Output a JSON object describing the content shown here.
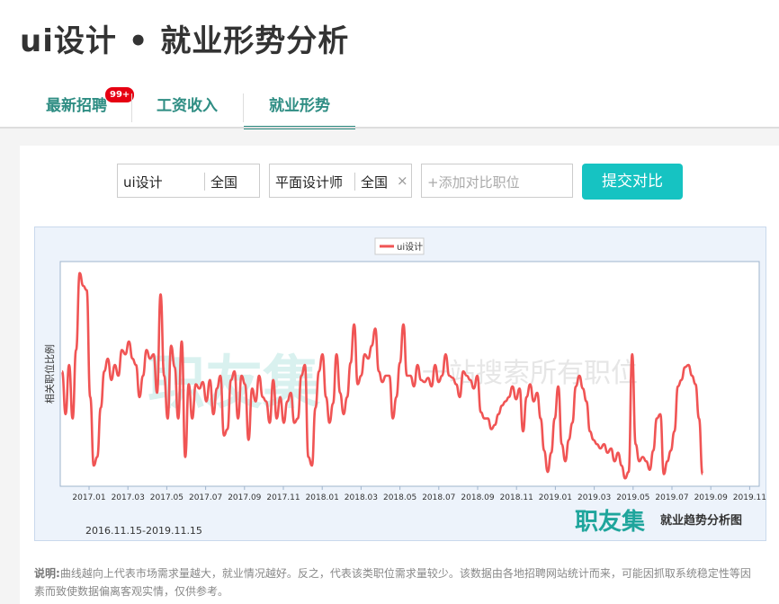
{
  "page": {
    "title": "ui设计 • 就业形势分析"
  },
  "tabs": [
    {
      "label": "最新招聘",
      "badge": "99+"
    },
    {
      "label": "工资收入"
    },
    {
      "label": "就业形势",
      "active": true
    }
  ],
  "compare": {
    "items": [
      {
        "job": "ui设计",
        "city": "全国"
      },
      {
        "job": "平面设计师",
        "city": "全国",
        "close": "×"
      }
    ],
    "add_placeholder": "+添加对比职位",
    "submit_label": "提交对比"
  },
  "chart_data": {
    "type": "line",
    "ylabel": "相关职位比例",
    "legend_placement": "top-center",
    "x_tick_labels": [
      "2017.01",
      "2017.03",
      "2017.05",
      "2017.07",
      "2017.09",
      "2017.11",
      "2018.01",
      "2018.03",
      "2018.05",
      "2018.07",
      "2018.09",
      "2018.11",
      "2019.01",
      "2019.03",
      "2019.05",
      "2019.07",
      "2019.09",
      "2019.11"
    ],
    "date_range": "2016.11.15-2019.11.15",
    "y_axis_labels_shown": false,
    "series": [
      {
        "name": "ui设计",
        "color": "#f05454",
        "comment_values": "relative values 0-100, sampled roughly every 7 days from 2016.11.15",
        "values": [
          52,
          32,
          55,
          30,
          62,
          98,
          92,
          90,
          40,
          8,
          12,
          35,
          52,
          58,
          48,
          55,
          50,
          62,
          60,
          66,
          58,
          55,
          40,
          50,
          62,
          58,
          60,
          42,
          88,
          50,
          30,
          64,
          54,
          30,
          66,
          12,
          46,
          30,
          46,
          44,
          47,
          38,
          48,
          32,
          44,
          50,
          22,
          25,
          48,
          52,
          30,
          50,
          46,
          20,
          44,
          38,
          50,
          40,
          38,
          28,
          48,
          30,
          40,
          28,
          38,
          42,
          28,
          30,
          50,
          55,
          12,
          8,
          35,
          52,
          60,
          40,
          28,
          37,
          60,
          42,
          32,
          40,
          56,
          74,
          46,
          50,
          60,
          58,
          64,
          72,
          52,
          47,
          50,
          50,
          30,
          40,
          56,
          74,
          50,
          50,
          45,
          55,
          48,
          47,
          49,
          45,
          55,
          47,
          50,
          60,
          50,
          49,
          46,
          40,
          52,
          50,
          48,
          44,
          50,
          33,
          30,
          30,
          25,
          27,
          32,
          36,
          38,
          40,
          45,
          39,
          44,
          24,
          40,
          46,
          38,
          42,
          30,
          15,
          5,
          14,
          30,
          45,
          18,
          10,
          20,
          28,
          45,
          50,
          44,
          38,
          24,
          20,
          18,
          16,
          18,
          14,
          16,
          10,
          14,
          8,
          2,
          5,
          60,
          18,
          10,
          12,
          10,
          6,
          15,
          30,
          32,
          4,
          10,
          15,
          24,
          45,
          48,
          54,
          55,
          50,
          46,
          30,
          4
        ]
      }
    ]
  },
  "watermark": {
    "brand": "职友集",
    "slogan": "一站搜索所有职位",
    "footer_brand": "职友集",
    "footer_caption": "就业趋势分析图"
  },
  "note": {
    "label": "说明:",
    "text": "曲线越向上代表市场需求量越大，就业情况越好。反之，代表该类职位需求量较少。该数据由各地招聘网站统计而来，可能因抓取系统稳定性等因素而致使数据偏离客观实情，仅供参考。"
  },
  "colors": {
    "accent": "#2e8d83",
    "button": "#16c3c2",
    "line": "#f05454",
    "badge": "#e60012"
  }
}
